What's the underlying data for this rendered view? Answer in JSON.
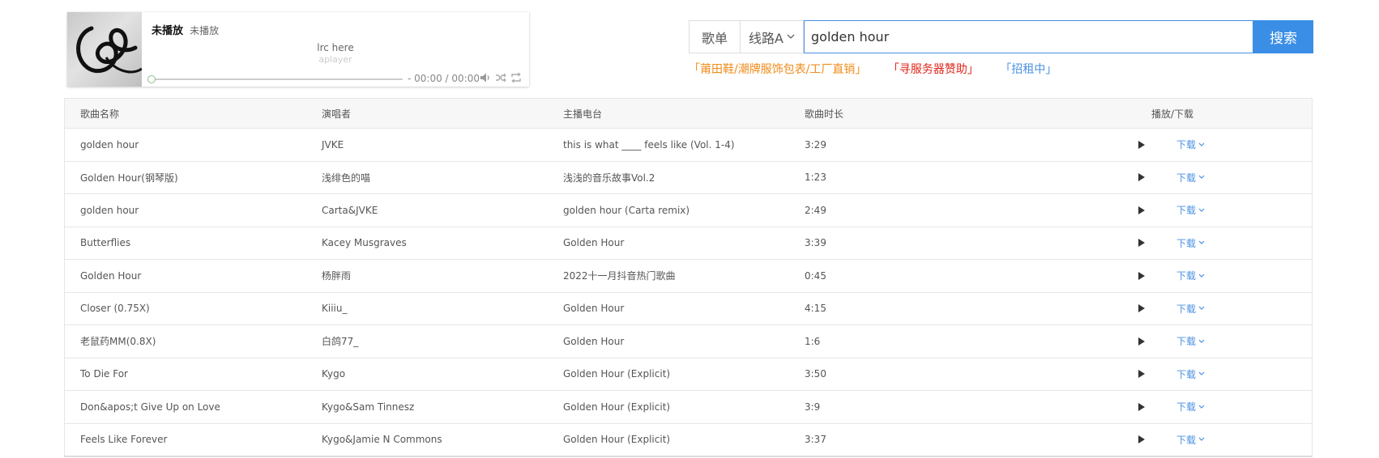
{
  "player": {
    "song_name": "未播放",
    "artist": "未播放",
    "lrc_line1": "lrc here",
    "lrc_line2": "aplayer",
    "time": "- 00:00 / 00:00",
    "progress": 0
  },
  "search": {
    "songlist_label": "歌单",
    "route_label": "线路A",
    "query": "golden hour",
    "button_label": "搜索"
  },
  "ads": [
    {
      "text": "「莆田鞋/潮牌服饰包表/工厂直销」",
      "color": "#f08c1a"
    },
    {
      "text": "「寻服务器赞助」",
      "color": "#e0261b"
    },
    {
      "text": "「招租中」",
      "color": "#4a90e2"
    }
  ],
  "table": {
    "headers": [
      "歌曲名称",
      "演唱者",
      "主播电台",
      "歌曲时长",
      "播放/下载"
    ],
    "download_label": "下载",
    "rows": [
      {
        "name": "golden hour",
        "singer": "JVKE",
        "album": "this is what ____ feels like (Vol. 1-4)",
        "duration": "3:29"
      },
      {
        "name": "Golden Hour(钢琴版)",
        "singer": "浅绯色的喵",
        "album": "浅浅的音乐故事Vol.2",
        "duration": "1:23"
      },
      {
        "name": "golden hour",
        "singer": "Carta&JVKE",
        "album": "golden hour (Carta remix)",
        "duration": "2:49"
      },
      {
        "name": "Butterflies",
        "singer": "Kacey Musgraves",
        "album": "Golden Hour",
        "duration": "3:39"
      },
      {
        "name": "Golden Hour",
        "singer": "杨胖雨",
        "album": "2022十一月抖音热门歌曲",
        "duration": "0:45"
      },
      {
        "name": "Closer (0.75X)",
        "singer": "Kiiiu_",
        "album": "Golden Hour",
        "duration": "4:15"
      },
      {
        "name": "老鼠药MM(0.8X)",
        "singer": "白鸽77_",
        "album": "Golden Hour",
        "duration": "1:6"
      },
      {
        "name": "To Die For",
        "singer": "Kygo",
        "album": "Golden Hour (Explicit)",
        "duration": "3:50"
      },
      {
        "name": "Don&apos;t Give Up on Love",
        "singer": "Kygo&Sam Tinnesz",
        "album": "Golden Hour (Explicit)",
        "duration": "3:9"
      },
      {
        "name": "Feels Like Forever",
        "singer": "Kygo&Jamie N Commons",
        "album": "Golden Hour (Explicit)",
        "duration": "3:37"
      }
    ]
  }
}
